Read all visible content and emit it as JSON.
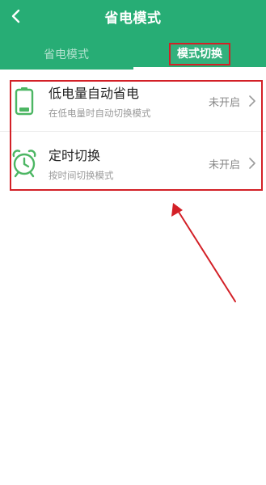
{
  "header": {
    "title": "省电模式",
    "back_icon": "chevron-left-icon",
    "tabs": [
      {
        "label": "省电模式",
        "active": false
      },
      {
        "label": "模式切换",
        "active": true
      }
    ]
  },
  "list": {
    "items": [
      {
        "title": "低电量自动省电",
        "subtitle": "在低电量时自动切换模式",
        "status": "未开启",
        "icon": "battery-icon"
      },
      {
        "title": "定时切换",
        "subtitle": "按时间切换模式",
        "status": "未开启",
        "icon": "alarm-clock-icon"
      }
    ]
  },
  "colors": {
    "header_bg": "#27ad75",
    "accent_green": "#4cb663",
    "annotation_red": "#d32027"
  }
}
